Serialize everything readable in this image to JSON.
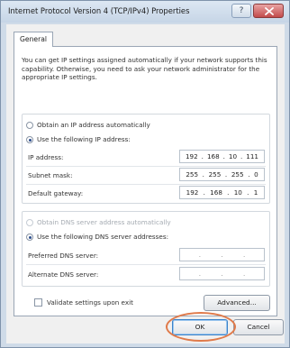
{
  "window": {
    "title": "Internet Protocol Version 4 (TCP/IPv4) Properties",
    "help_label": "?"
  },
  "tabs": [
    {
      "label": "General"
    }
  ],
  "intro_text": "You can get IP settings assigned automatically if your network supports this capability. Otherwise, you need to ask your network administrator for the appropriate IP settings.",
  "ip_section": {
    "auto_label": "Obtain an IP address automatically",
    "manual_label": "Use the following IP address:",
    "selected": "manual",
    "fields": [
      {
        "label": "IP address:",
        "octets": [
          "192",
          "168",
          "10",
          "111"
        ]
      },
      {
        "label": "Subnet mask:",
        "octets": [
          "255",
          "255",
          "255",
          "0"
        ]
      },
      {
        "label": "Default gateway:",
        "octets": [
          "192",
          "168",
          "10",
          "1"
        ]
      }
    ]
  },
  "dns_section": {
    "auto_label": "Obtain DNS server address automatically",
    "manual_label": "Use the following DNS server addresses:",
    "selected": "manual",
    "fields": [
      {
        "label": "Preferred DNS server:",
        "octets": [
          "",
          "",
          "",
          ""
        ]
      },
      {
        "label": "Alternate DNS server:",
        "octets": [
          "",
          "",
          "",
          ""
        ]
      }
    ]
  },
  "validate_label": "Validate settings upon exit",
  "validate_checked": false,
  "buttons": {
    "advanced": "Advanced...",
    "ok": "OK",
    "cancel": "Cancel"
  },
  "colors": {
    "highlight_ring": "#e07a4a",
    "close_button": "#c24b4b"
  }
}
